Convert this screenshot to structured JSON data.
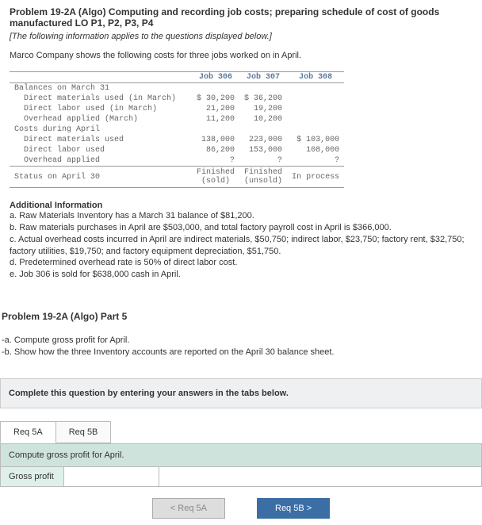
{
  "problem": {
    "title": "Problem 19-2A (Algo) Computing and recording job costs; preparing schedule of cost of goods manufactured LO P1, P2, P3, P4",
    "note": "[The following information applies to the questions displayed below.]",
    "intro": "Marco Company shows the following costs for three jobs worked on in April."
  },
  "table": {
    "headers": [
      "",
      "Job 306",
      "Job 307",
      "Job 308"
    ],
    "rows": [
      {
        "label": "Balances on March 31",
        "indent": false,
        "c1": "",
        "c2": "",
        "c3": ""
      },
      {
        "label": "Direct materials used (in March)",
        "indent": true,
        "c1": "$ 30,200",
        "c2": "$ 36,200",
        "c3": ""
      },
      {
        "label": "Direct labor used (in March)",
        "indent": true,
        "c1": "21,200",
        "c2": "19,200",
        "c3": ""
      },
      {
        "label": "Overhead applied (March)",
        "indent": true,
        "c1": "11,200",
        "c2": "10,200",
        "c3": ""
      },
      {
        "label": "Costs during April",
        "indent": false,
        "c1": "",
        "c2": "",
        "c3": ""
      },
      {
        "label": "Direct materials used",
        "indent": true,
        "c1": "138,000",
        "c2": "223,000",
        "c3": "$ 103,000"
      },
      {
        "label": "Direct labor used",
        "indent": true,
        "c1": "86,200",
        "c2": "153,000",
        "c3": "108,000"
      },
      {
        "label": "Overhead applied",
        "indent": true,
        "c1": "?",
        "c2": "?",
        "c3": "?"
      }
    ],
    "status": {
      "label": "Status on April 30",
      "c1": "Finished (sold)",
      "c2": "Finished (unsold)",
      "c3": "In process"
    }
  },
  "additional": {
    "title": "Additional Information",
    "a": "a. Raw Materials Inventory has a March 31 balance of $81,200.",
    "b": "b. Raw materials purchases in April are $503,000, and total factory payroll cost in April is $366,000.",
    "c": "c. Actual overhead costs incurred in April are indirect materials, $50,750; indirect labor, $23,750; factory rent, $32,750; factory utilities, $19,750; and factory equipment depreciation, $51,750.",
    "d": "d. Predetermined overhead rate is 50% of direct labor cost.",
    "e": "e. Job 306 is sold for $638,000 cash in April."
  },
  "part": {
    "title": "Problem 19-2A (Algo) Part 5",
    "sub_a": "-a. Compute gross profit for April.",
    "sub_b": "-b. Show how the three Inventory accounts are reported on the April 30 balance sheet."
  },
  "complete_bar": "Complete this question by entering your answers in the tabs below.",
  "tabs": {
    "t1": "Req 5A",
    "t2": "Req 5B"
  },
  "panel": {
    "instruction": "Compute gross profit for April.",
    "row_label": "Gross profit"
  },
  "nav": {
    "prev": "<  Req 5A",
    "next": "Req 5B  >"
  }
}
